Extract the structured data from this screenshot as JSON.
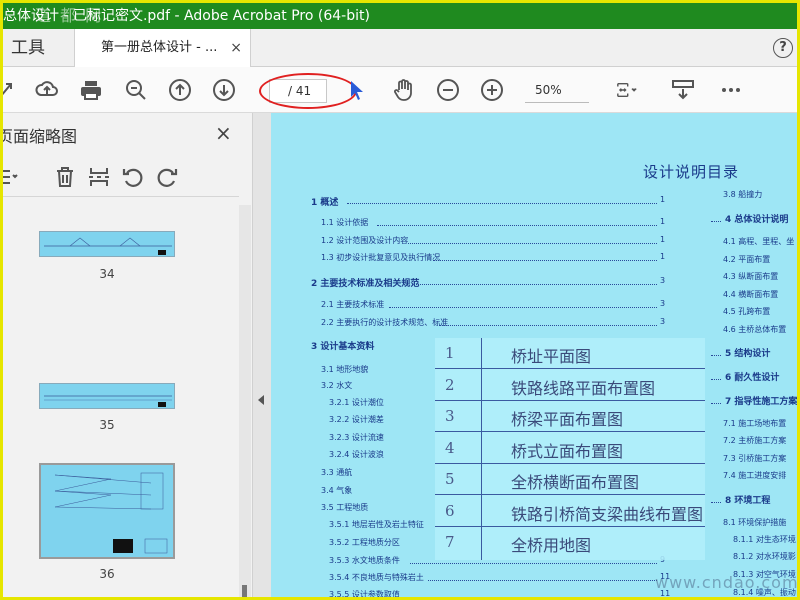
{
  "window": {
    "title": "总体设计 - 已标记密文.pdf - Adobe Acrobat Pro (64-bit)",
    "watermark_top": "道 都 网"
  },
  "tabs": {
    "tools_label": "工具",
    "doc_tab_label": "第一册总体设计 - ...",
    "doc_tab_close": "×",
    "help": "?"
  },
  "toolbar": {
    "page_total": "/ 41",
    "zoom": "50%",
    "icons": [
      "share-icon",
      "upload-icon",
      "print-icon",
      "search-icon",
      "page-up-icon",
      "page-down-icon",
      "cursor-icon",
      "hand-icon",
      "zoom-out-icon",
      "zoom-in-icon",
      "fit-page-icon",
      "scroll-mode-icon",
      "more-icon"
    ]
  },
  "left_panel": {
    "title": "页面缩略图",
    "close": "×",
    "thumbnails": [
      {
        "label": "34"
      },
      {
        "label": "35"
      },
      {
        "label": "36"
      }
    ]
  },
  "document": {
    "title": "设计说明目录",
    "toc_left": [
      {
        "text": "1  概述",
        "page": "1",
        "section": true
      },
      {
        "text": "1.1  设计依据",
        "page": "1",
        "section": false
      },
      {
        "text": "1.2  设计范围及设计内容",
        "page": "1",
        "section": false
      },
      {
        "text": "1.3  初步设计批复意见及执行情况",
        "page": "1",
        "section": false
      },
      {
        "text": "2  主要技术标准及相关规范",
        "page": "3",
        "section": true
      },
      {
        "text": "2.1  主要技术标准",
        "page": "3",
        "section": false
      },
      {
        "text": "2.2  主要执行的设计技术规范、标准",
        "page": "3",
        "section": false
      },
      {
        "text": "3  设计基本资料",
        "page": "",
        "section": true
      },
      {
        "text": "3.1  地形地貌",
        "page": "",
        "section": false
      },
      {
        "text": "3.2  水文",
        "page": "",
        "section": false
      },
      {
        "text": "3.2.1  设计潮位",
        "page": "",
        "section": false
      },
      {
        "text": "3.2.2  设计潮差",
        "page": "",
        "section": false
      },
      {
        "text": "3.2.3  设计流速",
        "page": "",
        "section": false
      },
      {
        "text": "3.2.4  设计波浪",
        "page": "",
        "section": false
      },
      {
        "text": "3.3  通航",
        "page": "",
        "section": false
      },
      {
        "text": "3.4  气象",
        "page": "",
        "section": false
      },
      {
        "text": "3.5  工程地质",
        "page": "",
        "section": false
      },
      {
        "text": "3.5.1  地层岩性及岩土特征",
        "page": "",
        "section": false
      },
      {
        "text": "3.5.2  工程地质分区",
        "page": "",
        "section": false
      },
      {
        "text": "3.5.3  水文地质条件",
        "page": "9",
        "section": false
      },
      {
        "text": "3.5.4  不良地质与特殊岩土",
        "page": "11",
        "section": false
      },
      {
        "text": "3.5.5  设计参数取值",
        "page": "11",
        "section": false
      }
    ],
    "toc_right": [
      {
        "text": "3.8  船撞力",
        "section": false
      },
      {
        "text": "4  总体设计说明",
        "section": true
      },
      {
        "text": "4.1  高程、里程、坐",
        "section": false
      },
      {
        "text": "4.2  平面布置",
        "section": false
      },
      {
        "text": "4.3  纵断面布置",
        "section": false
      },
      {
        "text": "4.4  横断面布置",
        "section": false
      },
      {
        "text": "4.5  孔跨布置",
        "section": false
      },
      {
        "text": "4.6  主桥总体布置",
        "section": false
      },
      {
        "text": "5  结构设计",
        "section": true
      },
      {
        "text": "6  耐久性设计",
        "section": true
      },
      {
        "text": "7  指导性施工方案",
        "section": true
      },
      {
        "text": "7.1  施工场地布置",
        "section": false
      },
      {
        "text": "7.2  主桥施工方案",
        "section": false
      },
      {
        "text": "7.3  引桥施工方案",
        "section": false
      },
      {
        "text": "7.4  施工进度安排",
        "section": false
      },
      {
        "text": "8  环境工程",
        "section": true
      },
      {
        "text": "8.1  环境保护措施",
        "section": false
      },
      {
        "text": "8.1.1  对生态环境",
        "section": false
      },
      {
        "text": "8.1.2  对水环境影",
        "section": false
      },
      {
        "text": "8.1.3  对空气环境",
        "section": false
      },
      {
        "text": "8.1.4  噪声、振动",
        "section": false
      }
    ],
    "overlay_rows": [
      {
        "num": "1",
        "text": "桥址平面图"
      },
      {
        "num": "2",
        "text": "铁路线路平面布置图"
      },
      {
        "num": "3",
        "text": "桥梁平面布置图"
      },
      {
        "num": "4",
        "text": "桥式立面布置图"
      },
      {
        "num": "5",
        "text": "全桥横断面布置图"
      },
      {
        "num": "6",
        "text": "铁路引桥简支梁曲线布置图"
      },
      {
        "num": "7",
        "text": "全桥用地图"
      }
    ],
    "watermark": "www.cndao.com"
  },
  "colors": {
    "titlebar": "#1f8a1f",
    "frame": "#e6e600",
    "doc_bg": "#9ee6f5",
    "annotation": "#e02020",
    "toc_text": "#1a3a8a"
  }
}
